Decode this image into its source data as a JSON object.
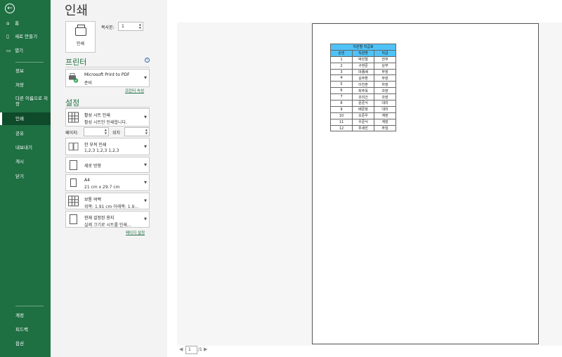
{
  "nav": {
    "items": [
      {
        "icon": "⌂",
        "label": "홈"
      },
      {
        "icon": "▯",
        "label": "새로 만들기"
      },
      {
        "icon": "▭",
        "label": "열기"
      }
    ],
    "sub_items": [
      "정보",
      "저장",
      "다른 이름으로 저장",
      "인쇄",
      "공유",
      "내보내기",
      "게시",
      "닫기"
    ],
    "bottom_items": [
      "계정",
      "피드백",
      "옵션"
    ],
    "active": "인쇄"
  },
  "header": {
    "title": "인쇄"
  },
  "print_button": {
    "label": "인쇄"
  },
  "copies": {
    "label": "복사본:",
    "value": "1"
  },
  "printer_section": {
    "title": "프린터",
    "name": "Microsoft Print to PDF",
    "status": "준비",
    "properties_link": "프린터 속성"
  },
  "settings_section": {
    "title": "설정",
    "scope": {
      "line1": "활성 시트 인쇄",
      "line2": "활성 시트만 인쇄합니다."
    },
    "pages": {
      "label": "페이지:",
      "to_label": "위치"
    },
    "sides": {
      "line1": "한 부씩 인쇄",
      "line2": "1,2,3    1,2,3    1,2,3"
    },
    "orientation": {
      "line1": "세로 방향"
    },
    "paper": {
      "line1": "A4",
      "line2": "21 cm x 29.7 cm"
    },
    "margins": {
      "line1": "보통 여백",
      "line2": "위쪽: 1.91 cm 아래쪽: 1.9..."
    },
    "scaling": {
      "line1": "현재 설정된 용지",
      "line2": "실제 크기로 시트를 인쇄..."
    },
    "page_setup_link": "페이지 설정"
  },
  "preview": {
    "table_title": "직원별 직급표",
    "columns": [
      "순번",
      "직원명",
      "직급"
    ],
    "rows": [
      [
        "1",
        "박민철",
        "전무"
      ],
      [
        "2",
        "구현준",
        "상무"
      ],
      [
        "3",
        "마종배",
        "부장"
      ],
      [
        "4",
        "김주환",
        "부장"
      ],
      [
        "5",
        "이진훈",
        "차장"
      ],
      [
        "6",
        "최주옥",
        "과장"
      ],
      [
        "7",
        "조미건",
        "과장"
      ],
      [
        "8",
        "문준식",
        "대리"
      ],
      [
        "9",
        "배준정",
        "대리"
      ],
      [
        "10",
        "오준우",
        "계장"
      ],
      [
        "11",
        "우준식",
        "계장"
      ],
      [
        "12",
        "위새힌",
        "주임"
      ]
    ],
    "pager": {
      "current": "1",
      "total": "/1"
    }
  },
  "colors": {
    "nav_green": "#1e6f42",
    "table_header": "#4fc3f7",
    "accent": "#1e6f42"
  }
}
